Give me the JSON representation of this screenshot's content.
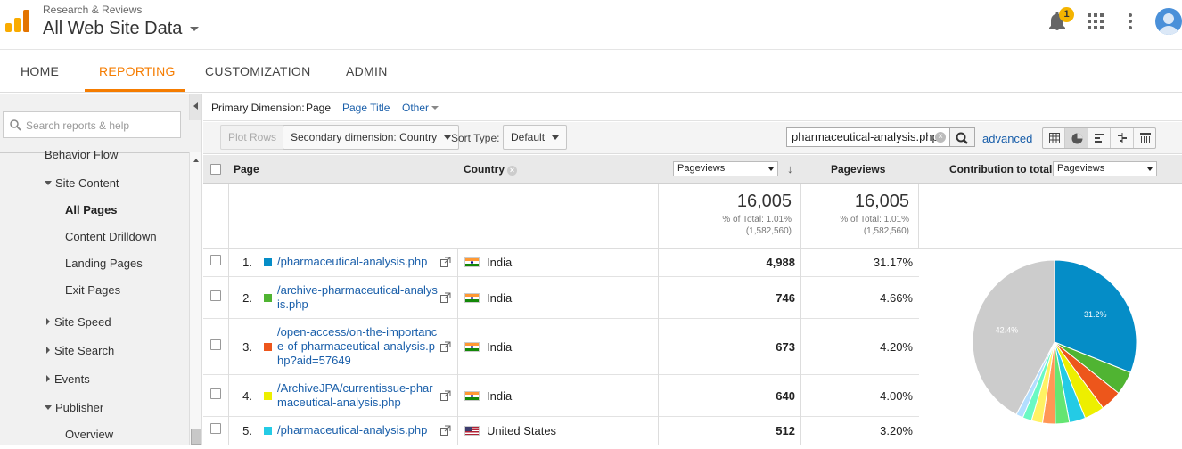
{
  "header": {
    "account": "Research & Reviews",
    "property": "All Web Site Data",
    "notification_count": "1"
  },
  "nav": {
    "tabs": [
      {
        "label": "HOME"
      },
      {
        "label": "REPORTING"
      },
      {
        "label": "CUSTOMIZATION"
      },
      {
        "label": "ADMIN"
      }
    ],
    "active": "REPORTING"
  },
  "sidebar": {
    "search_placeholder": "Search reports & help",
    "items": [
      {
        "label": "Behavior Flow"
      },
      {
        "label": "Site Content"
      },
      {
        "label": "All Pages"
      },
      {
        "label": "Content Drilldown"
      },
      {
        "label": "Landing Pages"
      },
      {
        "label": "Exit Pages"
      },
      {
        "label": "Site Speed"
      },
      {
        "label": "Site Search"
      },
      {
        "label": "Events"
      },
      {
        "label": "Publisher"
      },
      {
        "label": "Overview"
      }
    ]
  },
  "primary_dimension": {
    "label": "Primary Dimension:",
    "selected": "Page",
    "options": [
      "Page Title",
      "Other"
    ]
  },
  "toolbar": {
    "plot_rows": "Plot Rows",
    "secondary_dimension": "Secondary dimension: Country",
    "sort_type_label": "Sort Type:",
    "sort_type_value": "Default",
    "filter_value": "pharmaceutical-analysis.php",
    "advanced": "advanced"
  },
  "table": {
    "headers": {
      "page": "Page",
      "country": "Country",
      "metric_select": "Pageviews",
      "metric2": "Pageviews",
      "contribution_label": "Contribution to total:",
      "contribution_select": "Pageviews"
    },
    "summary": [
      {
        "value": "16,005",
        "pct_line": "% of Total: 1.01%",
        "total_line": "(1,582,560)"
      },
      {
        "value": "16,005",
        "pct_line": "% of Total: 1.01%",
        "total_line": "(1,582,560)"
      }
    ],
    "rows": [
      {
        "num": "1.",
        "page": "/pharmaceutical-analysis.php",
        "country": "India",
        "pageviews": "4,988",
        "pct": "31.17%",
        "color": "#058dc7"
      },
      {
        "num": "2.",
        "page": "/archive-pharmaceutical-analysis.php",
        "country": "India",
        "pageviews": "746",
        "pct": "4.66%",
        "color": "#50b432"
      },
      {
        "num": "3.",
        "page": "/open-access/on-the-importance-of-pharmaceutical-analysis.php?aid=57649",
        "country": "India",
        "pageviews": "673",
        "pct": "4.20%",
        "color": "#ed561b"
      },
      {
        "num": "4.",
        "page": "/ArchiveJPA/currentissue-pharmaceutical-analysis.php",
        "country": "India",
        "pageviews": "640",
        "pct": "4.00%",
        "color": "#edef00"
      },
      {
        "num": "5.",
        "page": "/pharmaceutical-analysis.php",
        "country": "United States",
        "pageviews": "512",
        "pct": "3.20%",
        "color": "#24cbe5"
      }
    ]
  },
  "chart_data": {
    "type": "pie",
    "slices": [
      {
        "label": "31.2%",
        "value": 31.17,
        "color": "#058dc7"
      },
      {
        "value": 4.66,
        "color": "#50b432"
      },
      {
        "value": 4.2,
        "color": "#ed561b"
      },
      {
        "value": 4.0,
        "color": "#edef00"
      },
      {
        "value": 3.2,
        "color": "#24cbe5"
      },
      {
        "value": 2.8,
        "color": "#64e572"
      },
      {
        "value": 2.5,
        "color": "#ff9655"
      },
      {
        "value": 2.2,
        "color": "#fff263"
      },
      {
        "value": 1.8,
        "color": "#6af9c4"
      },
      {
        "value": 1.4,
        "color": "#b2deff"
      },
      {
        "label": "42.4%",
        "value": 42.4,
        "color": "#cccccc"
      }
    ]
  }
}
